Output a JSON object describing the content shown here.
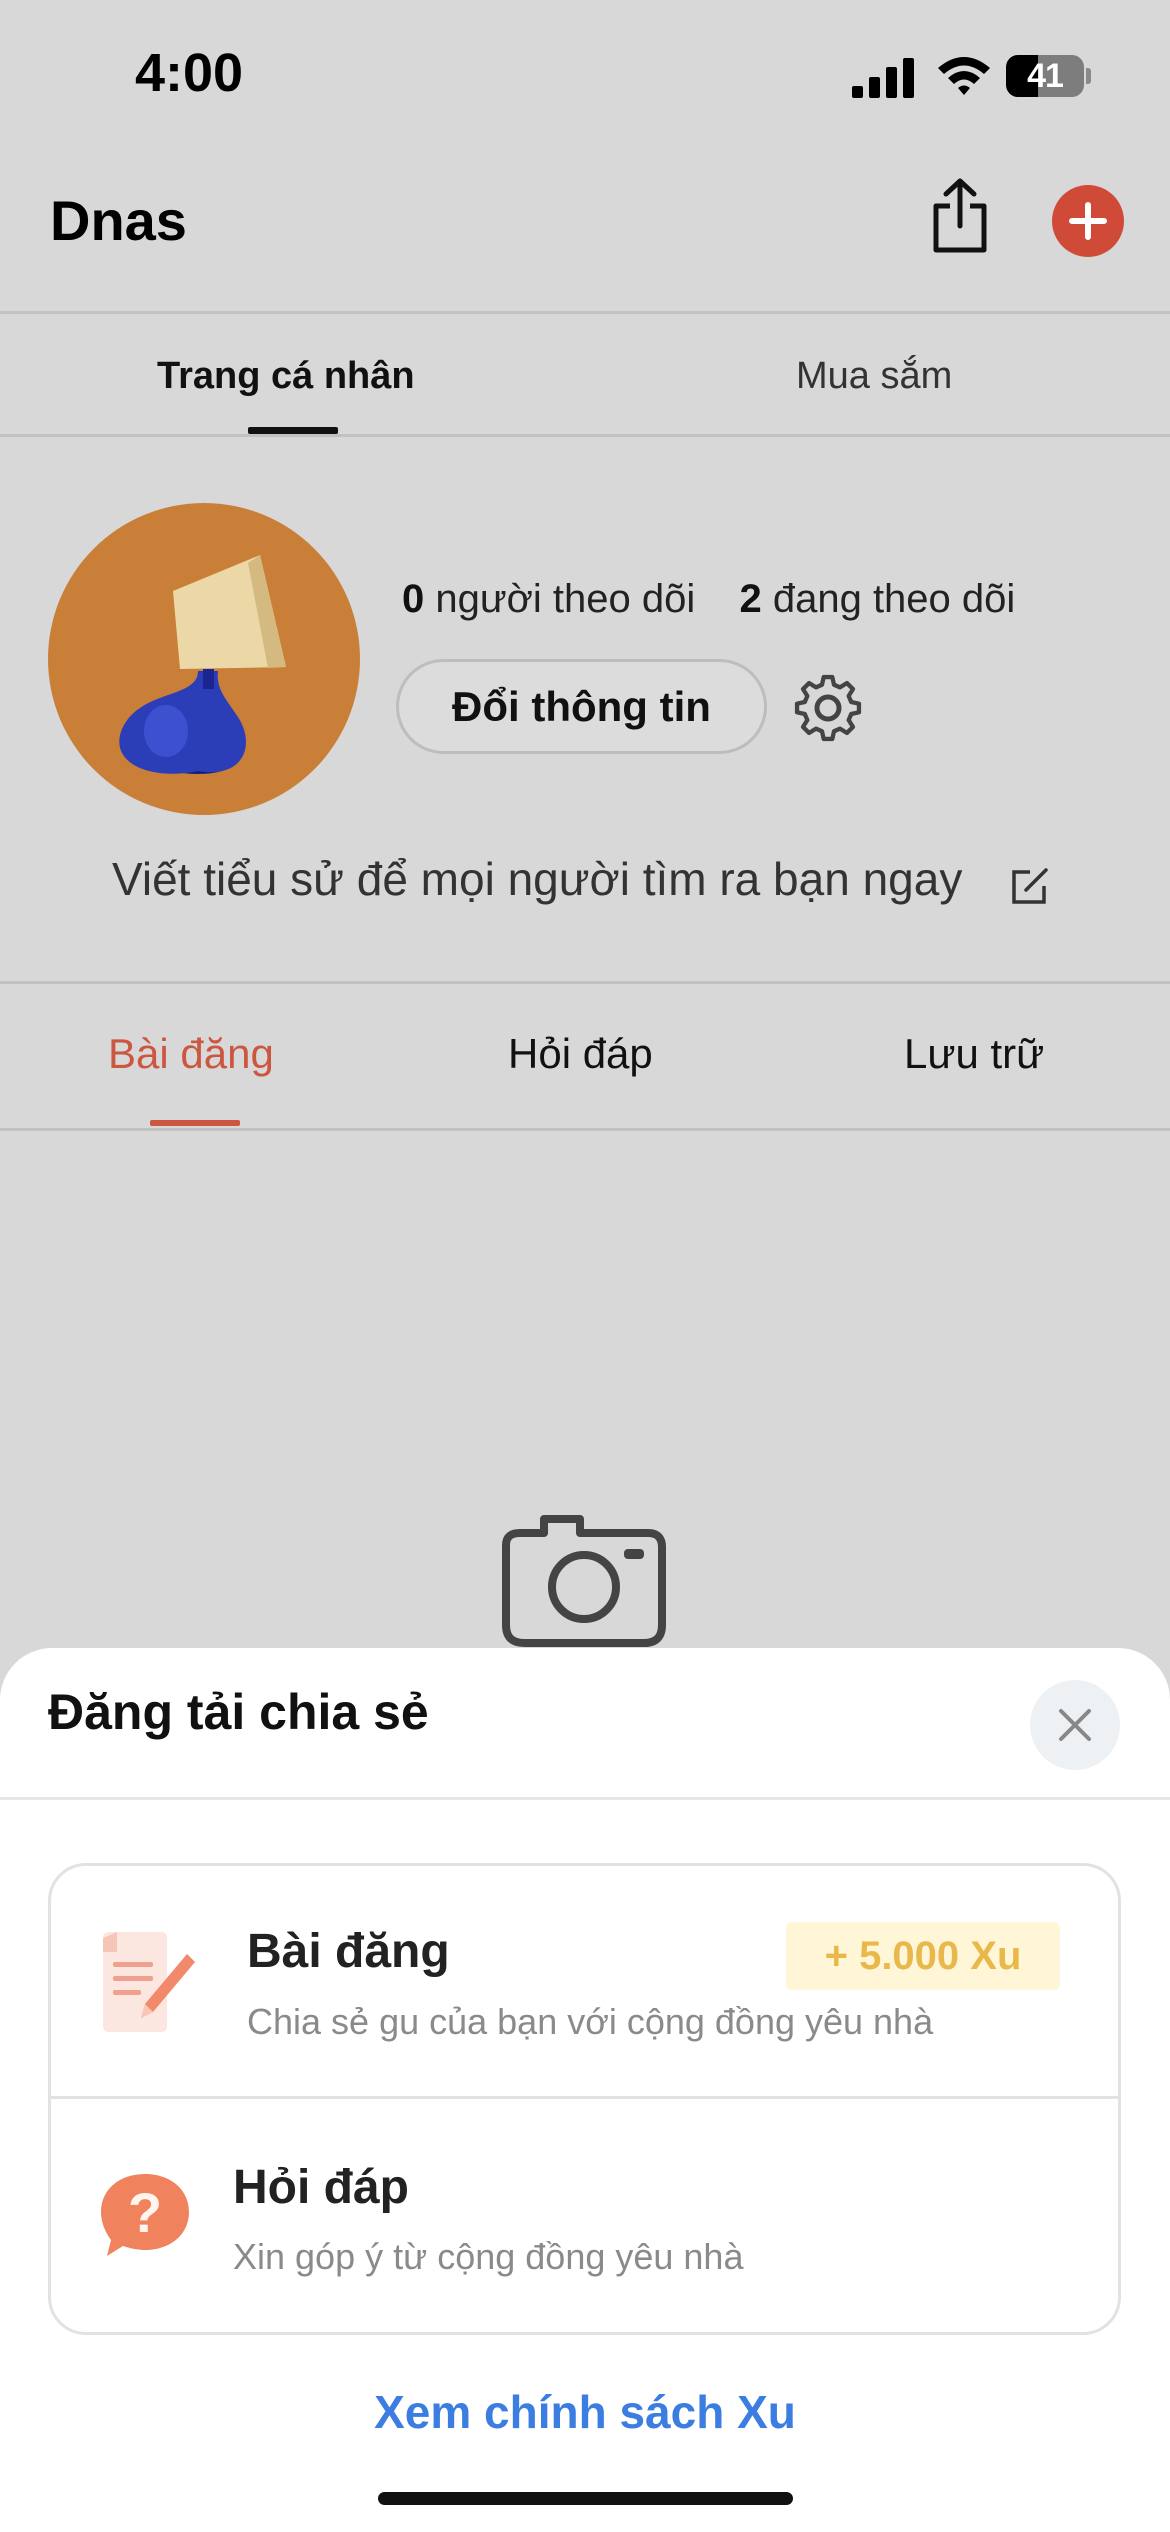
{
  "status_bar": {
    "time": "4:00",
    "battery_level": "41",
    "icons": [
      "signal-icon",
      "wifi-icon",
      "battery-icon"
    ]
  },
  "header": {
    "title": "Dnas",
    "icons": [
      "share-icon",
      "add-icon"
    ],
    "accent_color": "#d04a38"
  },
  "top_tabs": [
    {
      "label": "Trang cá nhân",
      "active": true
    },
    {
      "label": "Mua sắm",
      "active": false
    }
  ],
  "profile": {
    "followers_count": "0",
    "followers_label": "người theo dõi",
    "following_count": "2",
    "following_label": "đang theo dõi",
    "edit_button_label": "Đổi thông tin",
    "bio_placeholder": "Viết tiểu sử để mọi người tìm ra bạn ngay",
    "avatar_icon": "lamp-avatar",
    "settings_icon": "gear-icon"
  },
  "content_tabs": [
    {
      "label": "Bài đăng",
      "active": true
    },
    {
      "label": "Hỏi đáp",
      "active": false
    },
    {
      "label": "Lưu trữ",
      "active": false
    }
  ],
  "empty_state": {
    "icon": "camera-icon"
  },
  "sheet": {
    "title": "Đăng tải chia sẻ",
    "close_icon": "close-icon",
    "options": [
      {
        "title": "Bài đăng",
        "description": "Chia sẻ gu của bạn với cộng đồng yêu nhà",
        "badge": "+ 5.000 Xu",
        "icon": "note-pencil-icon"
      },
      {
        "title": "Hỏi đáp",
        "description": "Xin góp ý từ cộng đồng yêu nhà",
        "icon": "question-bubble-icon"
      }
    ],
    "policy_link": "Xem chính sách Xu",
    "link_color": "#3b7de0",
    "highlight_color": "#cc5740"
  }
}
